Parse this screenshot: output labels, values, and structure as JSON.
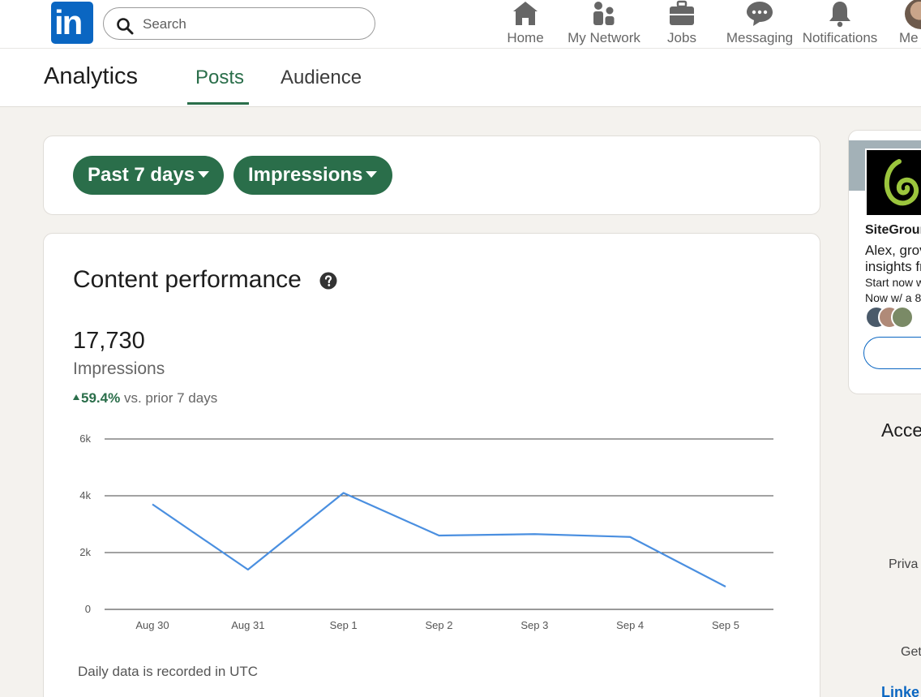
{
  "nav": {
    "logo_text": "in",
    "search_placeholder": "Search",
    "items": [
      {
        "label": "Home",
        "icon": "home-icon"
      },
      {
        "label": "My Network",
        "icon": "network-icon"
      },
      {
        "label": "Jobs",
        "icon": "briefcase-icon"
      },
      {
        "label": "Messaging",
        "icon": "messaging-icon"
      },
      {
        "label": "Notifications",
        "icon": "bell-icon"
      },
      {
        "label": "Me",
        "icon": "avatar"
      }
    ]
  },
  "header": {
    "title": "Analytics",
    "tabs": [
      {
        "label": "Posts",
        "active": true
      },
      {
        "label": "Audience",
        "active": false
      }
    ]
  },
  "filters": {
    "period": "Past 7 days",
    "metric": "Impressions"
  },
  "performance": {
    "title": "Content performance",
    "total": "17,730",
    "metric_label": "Impressions",
    "change": "59.4%",
    "change_suffix": "vs. prior 7 days",
    "footnote": "Daily data is recorded in UTC"
  },
  "chart_data": {
    "type": "line",
    "categories": [
      "Aug 30",
      "Aug 31",
      "Sep 1",
      "Sep 2",
      "Sep 3",
      "Sep 4",
      "Sep 5"
    ],
    "values": [
      3700,
      1400,
      4100,
      2600,
      2650,
      2550,
      800
    ],
    "y_ticks": [
      "0",
      "2k",
      "4k",
      "6k"
    ],
    "ylim": [
      0,
      6000
    ],
    "grid": true,
    "line_color": "#4a8fe0"
  },
  "ad": {
    "name": "SiteGroun",
    "line1": "Alex, grov",
    "line2": "insights fr",
    "small1": "Start now w",
    "small2": "Now w/ a 8"
  },
  "rail": {
    "acce": "Acce",
    "priva": "Priva",
    "get": "Get",
    "linked": "Linke"
  },
  "colors": {
    "brand": "#0a66c2",
    "accent_green": "#2a6e4a"
  }
}
